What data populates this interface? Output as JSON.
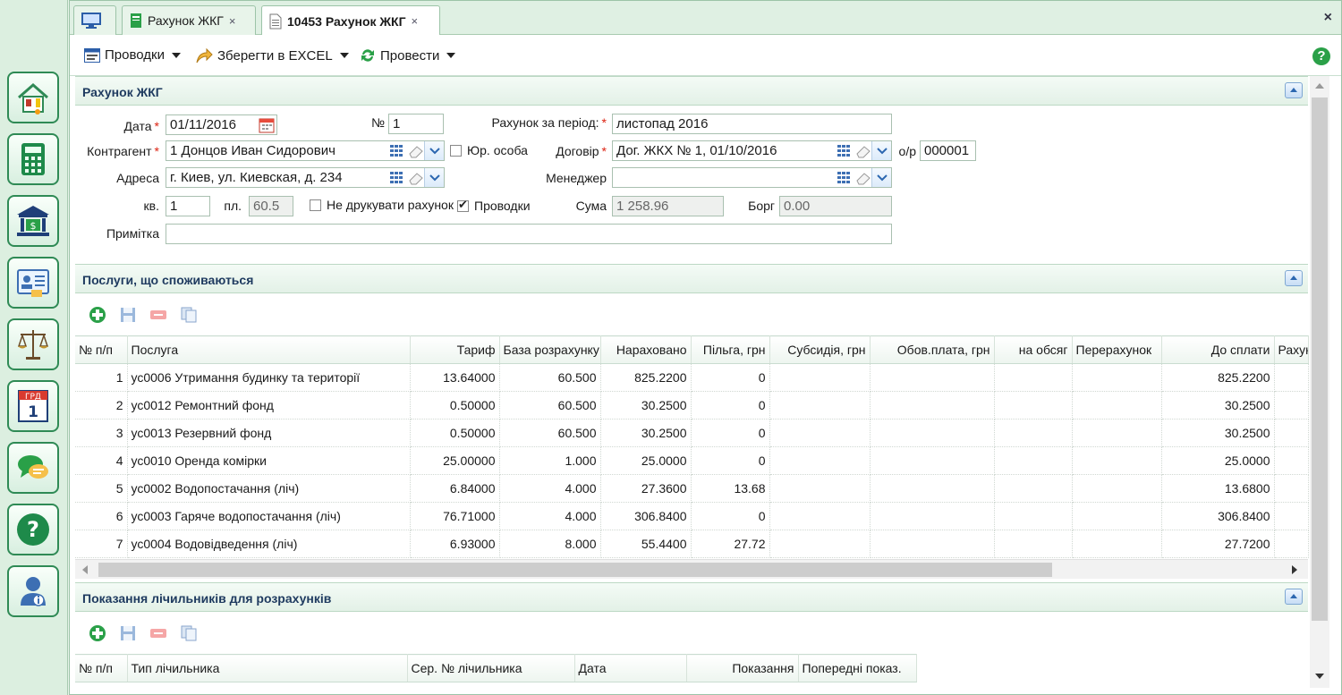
{
  "colors": {
    "accent_green": "#2f8a55",
    "header_text": "#1e3a5f",
    "required_mark": "#d21"
  },
  "sidebar": {
    "items": [
      {
        "icon": "house-utilities-icon"
      },
      {
        "icon": "calculator-icon"
      },
      {
        "icon": "bank-icon"
      },
      {
        "icon": "id-card-icon"
      },
      {
        "icon": "scales-icon"
      },
      {
        "icon": "calendar-icon",
        "text_top": "ГРД",
        "text_num": "1"
      },
      {
        "icon": "chat-bubbles-icon"
      },
      {
        "icon": "help-icon"
      },
      {
        "icon": "user-info-icon"
      }
    ]
  },
  "tabs": [
    {
      "label": "",
      "icon": "monitor-icon"
    },
    {
      "label": "Рахунок ЖКГ",
      "icon": "notebook-icon",
      "close": "×"
    },
    {
      "label": "10453 Рахунок ЖКГ",
      "icon": "document-icon",
      "close": "×"
    }
  ],
  "tab_close_all": "×",
  "toolbar": {
    "postings_label": "Проводки",
    "excel_label": "Зберегти в EXCEL",
    "post_label": "Провести",
    "help": "?"
  },
  "form": {
    "title": "Рахунок ЖКГ",
    "date_label": "Дата",
    "date_value": "01/11/2016",
    "number_label": "№",
    "number_value": "1",
    "period_label": "Рахунок за період:",
    "period_value": "листопад 2016",
    "contractor_label": "Контрагент",
    "contractor_value": "1 Донцов Иван Сидорович",
    "legal_entity_label": "Юр. особа",
    "contract_label": "Договір",
    "contract_value": "Дог. ЖКХ № 1, 01/10/2016",
    "account_label": "о/р",
    "account_value": "000001",
    "address_label": "Адреса",
    "address_value": "г. Киев, ул. Киевская, д. 234",
    "manager_label": "Менеджер",
    "manager_value": "",
    "apt_label": "кв.",
    "apt_value": "1",
    "area_label": "пл.",
    "area_value": "60.5",
    "no_print_label": "Не друкувати рахунок",
    "postings_label": "Проводки",
    "sum_label": "Сума",
    "sum_value": "1 258.96",
    "debt_label": "Борг",
    "debt_value": "0.00",
    "note_label": "Примітка",
    "note_value": ""
  },
  "services": {
    "title": "Послуги, що споживаються",
    "columns": [
      "№ п/п",
      "Послуга",
      "Тариф",
      "База розрахунку",
      "Нараховано",
      "Пільга, грн",
      "Субсидія, грн",
      "Обов.плата, грн",
      "на обсяг",
      "Перерахунок",
      "До сплати",
      "Рахунок"
    ],
    "rows": [
      [
        "1",
        "ус0006 Утримання будинку та території",
        "13.64000",
        "60.500",
        "825.2200",
        "0",
        "",
        "",
        "",
        "",
        "825.2200",
        ""
      ],
      [
        "2",
        "ус0012 Ремонтний фонд",
        "0.50000",
        "60.500",
        "30.2500",
        "0",
        "",
        "",
        "",
        "",
        "30.2500",
        ""
      ],
      [
        "3",
        "ус0013 Резервний фонд",
        "0.50000",
        "60.500",
        "30.2500",
        "0",
        "",
        "",
        "",
        "",
        "30.2500",
        ""
      ],
      [
        "4",
        "ус0010 Оренда комірки",
        "25.00000",
        "1.000",
        "25.0000",
        "0",
        "",
        "",
        "",
        "",
        "25.0000",
        ""
      ],
      [
        "5",
        "ус0002 Водопостачання (ліч)",
        "6.84000",
        "4.000",
        "27.3600",
        "13.68",
        "",
        "",
        "",
        "",
        "13.6800",
        ""
      ],
      [
        "6",
        "ус0003 Гаряче водопостачання (ліч)",
        "76.71000",
        "4.000",
        "306.8400",
        "0",
        "",
        "",
        "",
        "",
        "306.8400",
        ""
      ],
      [
        "7",
        "ус0004 Водовідведення (ліч)",
        "6.93000",
        "8.000",
        "55.4400",
        "27.72",
        "",
        "",
        "",
        "",
        "27.7200",
        ""
      ]
    ]
  },
  "meters": {
    "title": "Показання лічильників для розрахунків",
    "columns": [
      "№ п/п",
      "Тип лічильника",
      "Сер. № лічильника",
      "Дата",
      "Показання",
      "Попередні показ."
    ]
  }
}
